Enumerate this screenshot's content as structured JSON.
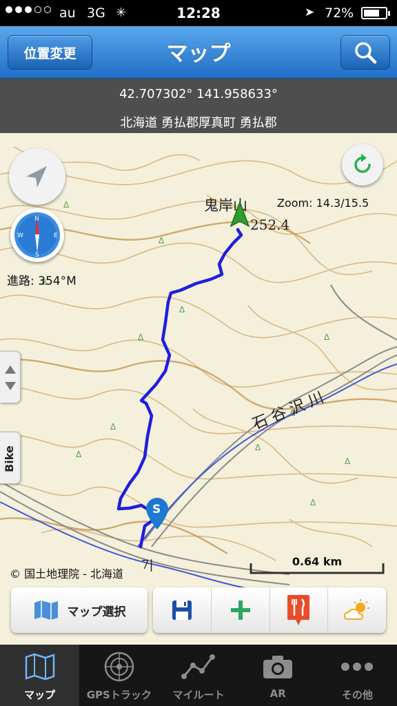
{
  "status_bar": {
    "signal_dots": [
      true,
      true,
      true,
      false,
      false
    ],
    "carrier": "au",
    "network": "3G",
    "time": "12:28",
    "battery": "72%",
    "battery_level": 0.72
  },
  "nav": {
    "left_button": "位置変更",
    "title": "マップ",
    "right_icon": "search-icon"
  },
  "location": {
    "coordinates": "42.707302° 141.958633°",
    "address": "北海道 勇払郡厚真町 勇払郡"
  },
  "map": {
    "peak_label": "鬼岸山",
    "elevation_label": "252.4",
    "river_label": "石 谷 沢 川",
    "heading_label": "進路: 354°M",
    "zoom_label": "Zoom: 14.3/15.5",
    "start_marker": "S",
    "place_mark": "7|",
    "copyright": "© 国土地理院 - 北海道",
    "scale_label": "0.64 km",
    "bike_tab": "Bike",
    "accent_color": "#1e57d6"
  },
  "toolbar": {
    "map_select_label": "マップ選択",
    "icons": [
      "save-icon",
      "add-icon",
      "restaurant-icon",
      "weather-icon"
    ]
  },
  "tabs": [
    {
      "label": "マップ",
      "icon": "map-icon",
      "active": true
    },
    {
      "label": "GPSトラック",
      "icon": "radar-icon",
      "active": false
    },
    {
      "label": "マイルート",
      "icon": "route-icon",
      "active": false
    },
    {
      "label": "AR",
      "icon": "camera-icon",
      "active": false
    },
    {
      "label": "その他",
      "icon": "more-icon",
      "active": false
    }
  ]
}
